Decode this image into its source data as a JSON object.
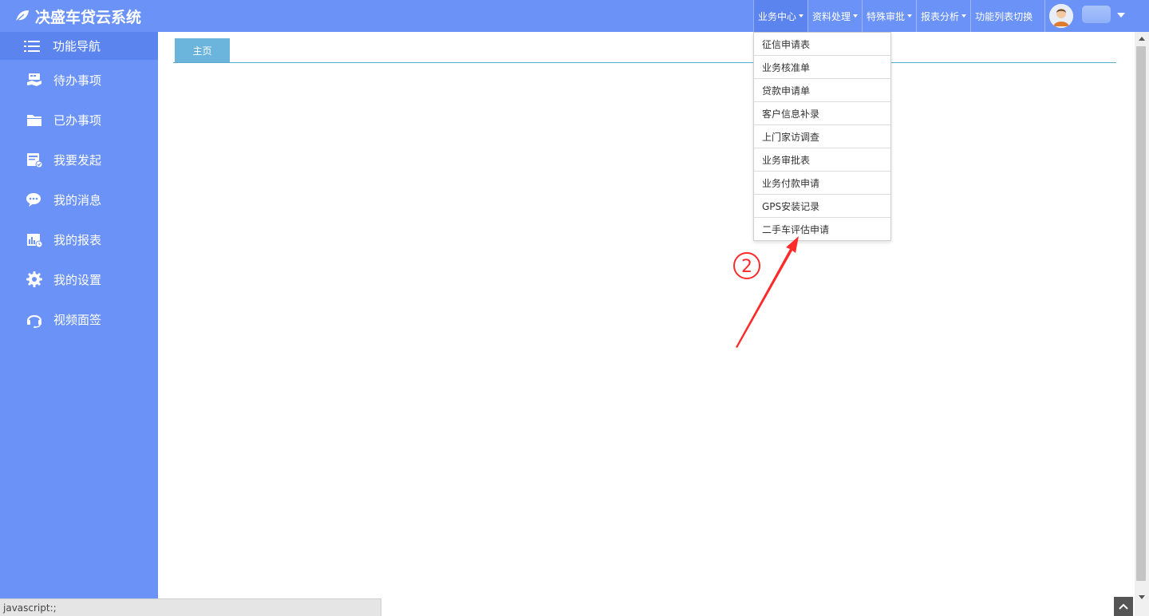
{
  "app": {
    "title": "决盛车贷云系统"
  },
  "top_nav": [
    {
      "label": "业务中心",
      "active": true
    },
    {
      "label": "资料处理"
    },
    {
      "label": "特殊审批"
    },
    {
      "label": "报表分析"
    },
    {
      "label": "功能列表切换"
    }
  ],
  "sidebar": {
    "header": "功能导航",
    "items": [
      {
        "label": "待办事项",
        "icon": "handshake-icon"
      },
      {
        "label": "已办事项",
        "icon": "folder-icon"
      },
      {
        "label": "我要发起",
        "icon": "form-icon"
      },
      {
        "label": "我的消息",
        "icon": "chat-icon"
      },
      {
        "label": "我的报表",
        "icon": "report-icon"
      },
      {
        "label": "我的设置",
        "icon": "gear-icon"
      },
      {
        "label": "视频面签",
        "icon": "headset-icon"
      }
    ]
  },
  "tabs": [
    {
      "label": "主页"
    }
  ],
  "dropdown": {
    "items": [
      "征信申请表",
      "业务核准单",
      "贷款申请单",
      "客户信息补录",
      "上门家访调查",
      "业务审批表",
      "业务付款申请",
      "GPS安装记录",
      "二手车评估申请"
    ]
  },
  "annotation": {
    "label": "2",
    "color": "#ff2a2a"
  },
  "status_bar": {
    "text": "javascript:;"
  },
  "colors": {
    "nav_blue": "#6b93f7",
    "nav_blue_dark": "#5b84ef",
    "tab_blue": "#6bb5dc"
  }
}
